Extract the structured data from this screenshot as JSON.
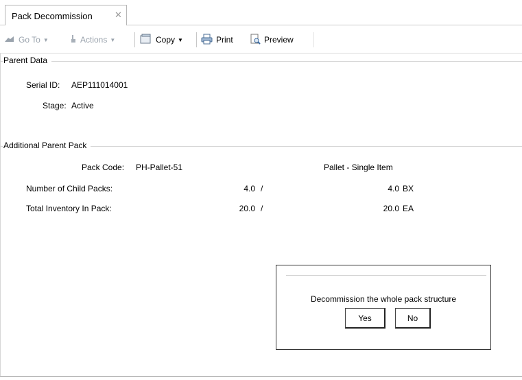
{
  "tab": {
    "title": "Pack Decommission",
    "close": "✕"
  },
  "toolbar": {
    "goto_label": "Go To",
    "actions_label": "Actions",
    "copy_label": "Copy",
    "print_label": "Print",
    "preview_label": "Preview"
  },
  "parent_data": {
    "section_title": "Parent Data",
    "serial_label": "Serial ID:",
    "serial_value": "AEP111014001",
    "stage_label": "Stage:",
    "stage_value": "Active"
  },
  "additional_parent_pack": {
    "section_title": "Additional Parent Pack",
    "pack_code_label": "Pack Code:",
    "pack_code_value": "PH-Pallet-51",
    "pack_type": "Pallet - Single Item",
    "rows": [
      {
        "label": "Number of Child Packs:",
        "current": "4.0",
        "sep": "/",
        "total": "4.0",
        "unit": "BX"
      },
      {
        "label": "Total Inventory In Pack:",
        "current": "20.0",
        "sep": "/",
        "total": "20.0",
        "unit": "EA"
      }
    ]
  },
  "dialog": {
    "message": "Decommission the whole pack structure",
    "yes_label": "Yes",
    "no_label": "No"
  }
}
